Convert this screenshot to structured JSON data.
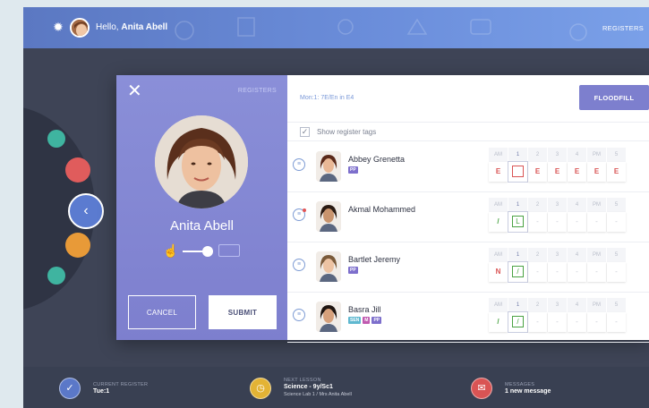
{
  "topbar": {
    "greeting": "Hello,",
    "user_name": "Anita Abell",
    "registers_link": "REGISTERS"
  },
  "panel": {
    "registers_label": "REGISTERS",
    "teacher_name": "Anita Abell",
    "cancel_label": "CANCEL",
    "submit_label": "SUBMIT"
  },
  "content": {
    "breadcrumb": "Mon:1: 7E/En in E4",
    "floodfill_label": "FLOODFILL",
    "show_tags_label": "Show register tags",
    "show_tags_checked": true,
    "headers": [
      "AM",
      "1",
      "2",
      "3",
      "4",
      "PM",
      "5"
    ],
    "pupils": [
      {
        "name": "Abbey Grenetta",
        "badges": [
          "PP"
        ],
        "marks": [
          "E",
          "",
          "E",
          "E",
          "E",
          "E",
          "E"
        ],
        "current_mark_color": "red",
        "row_color": "red"
      },
      {
        "name": "Akmal Mohammed",
        "badges": [],
        "marks": [
          "/",
          "L",
          "-",
          "-",
          "-",
          "-",
          "-"
        ],
        "current_mark_color": "green",
        "row_color": "green",
        "comment_alert": true
      },
      {
        "name": "Bartlet Jeremy",
        "badges": [
          "PP"
        ],
        "marks": [
          "N",
          "/",
          "-",
          "-",
          "-",
          "-",
          "-"
        ],
        "current_mark_color": "green",
        "row_color": "red"
      },
      {
        "name": "Basra Jill",
        "badges": [
          "SEN",
          "M",
          "PP"
        ],
        "marks": [
          "/",
          "/",
          "-",
          "-",
          "-",
          "-",
          "-"
        ],
        "current_mark_color": "green",
        "row_color": "green"
      }
    ]
  },
  "footer": {
    "current_register_label": "CURRENT REGISTER",
    "current_register_value": "Tue:1",
    "next_lesson_label": "NEXT LESSON",
    "next_lesson_value": "Science - 9y/Sc1",
    "next_lesson_sub": "Science Lab 1 / Mrs Anita Abell",
    "messages_label": "MESSAGES",
    "messages_value": "1 new message"
  },
  "colors": {
    "accent": "#7d7fce",
    "topbar": "#6c8fdc",
    "mark_red": "#d95454",
    "mark_green": "#4aa343",
    "badge_pp": "#7d6fcc",
    "badge_sen": "#5fb8d0",
    "badge_m": "#c05ab0"
  },
  "icons": {
    "settings": "gear-icon",
    "close": "close-icon",
    "back": "chevron-left-icon",
    "comment": "comment-icon",
    "touch": "hand-touch-icon",
    "keyboard": "keyboard-icon"
  }
}
